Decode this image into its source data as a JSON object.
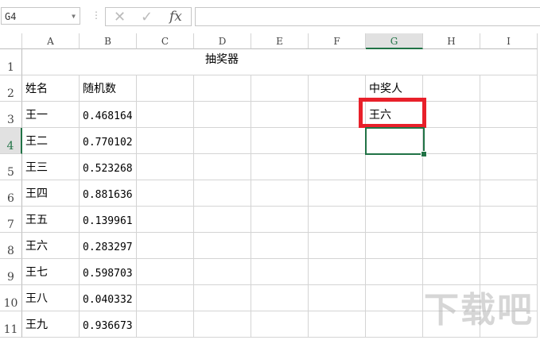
{
  "formula_bar": {
    "name_box": "G4",
    "cancel_icon": "✕",
    "enter_icon": "✓",
    "fx_label": "fx",
    "formula": ""
  },
  "columns": [
    "A",
    "B",
    "C",
    "D",
    "E",
    "F",
    "G",
    "H",
    "I"
  ],
  "rows": [
    "1",
    "2",
    "3",
    "4",
    "5",
    "6",
    "7",
    "8",
    "9",
    "10",
    "11"
  ],
  "selected_cell": {
    "column": "G",
    "row": "4"
  },
  "title": "抽奖器",
  "headers": {
    "name": "姓名",
    "random": "随机数",
    "winner": "中奖人"
  },
  "entries": [
    {
      "name": "王一",
      "value": "0.468164"
    },
    {
      "name": "王二",
      "value": "0.770102"
    },
    {
      "name": "王三",
      "value": "0.523268"
    },
    {
      "name": "王四",
      "value": "0.881636"
    },
    {
      "name": "王五",
      "value": "0.139961"
    },
    {
      "name": "王六",
      "value": "0.283297"
    },
    {
      "name": "王七",
      "value": "0.598703"
    },
    {
      "name": "王八",
      "value": "0.040332"
    },
    {
      "name": "王九",
      "value": "0.936673"
    }
  ],
  "winner": "王六",
  "watermark": "下载吧",
  "colors": {
    "selection": "#217346",
    "highlight": "#e8202a"
  }
}
